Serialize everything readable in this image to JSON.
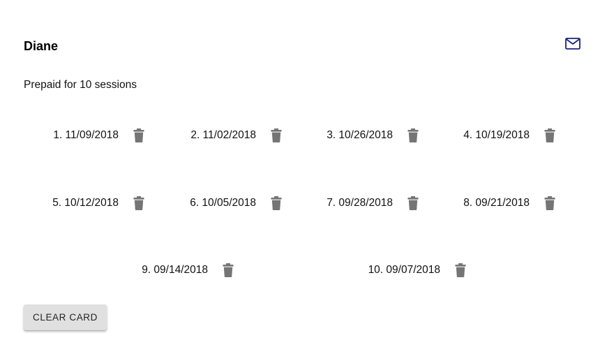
{
  "card": {
    "name": "Diane",
    "prepaid_text": "Prepaid for 10 sessions",
    "mail_icon": "mail-icon",
    "accent_color": "#1a237e"
  },
  "sessions": [
    {
      "label": "1. 11/09/2018"
    },
    {
      "label": "2. 11/02/2018"
    },
    {
      "label": "3. 10/26/2018"
    },
    {
      "label": "4. 10/19/2018"
    },
    {
      "label": "5. 10/12/2018"
    },
    {
      "label": "6. 10/05/2018"
    },
    {
      "label": "7. 09/28/2018"
    },
    {
      "label": "8. 09/21/2018"
    },
    {
      "label": "9. 09/14/2018"
    },
    {
      "label": "10. 09/07/2018"
    }
  ],
  "delete_icon": "trash-icon",
  "clear_button_label": "CLEAR CARD"
}
